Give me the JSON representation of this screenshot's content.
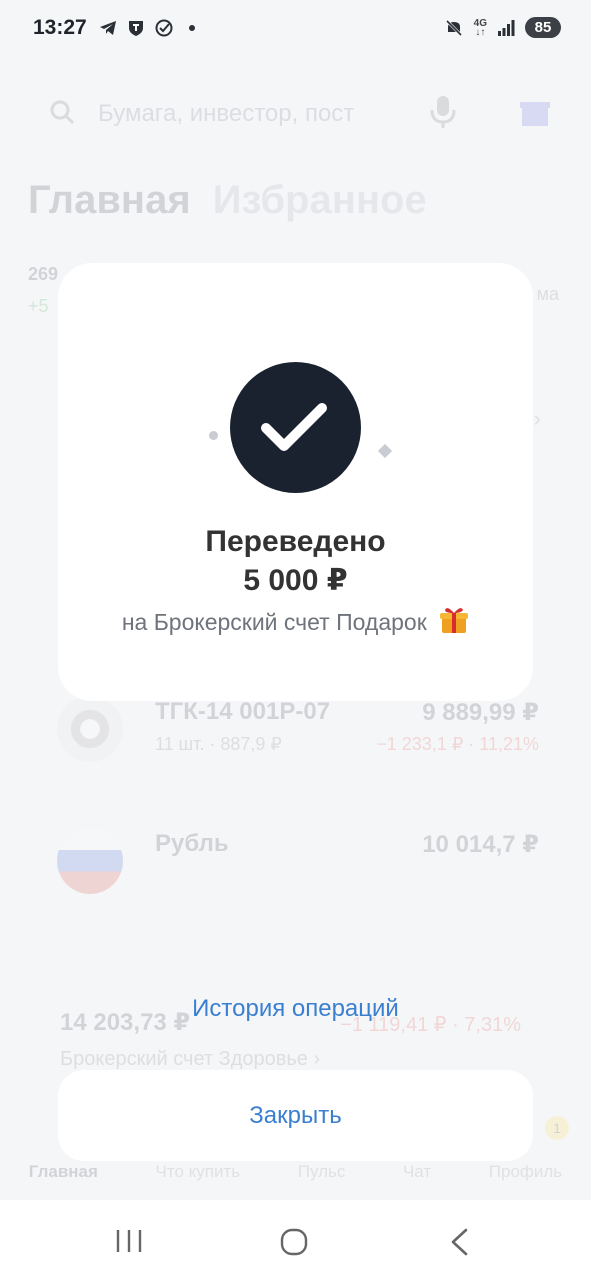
{
  "status_bar": {
    "time": "13:27",
    "network": "4G",
    "battery": "85",
    "icons": [
      "telegram-icon",
      "shield-icon",
      "check-circle-icon",
      "dot-icon",
      "mute-icon",
      "signal-icon"
    ]
  },
  "background": {
    "search_placeholder": "Бумага, инвестор, пост",
    "tab_main": "Главная",
    "tab_favorites": "Избранное",
    "mini_value": "269",
    "mini_change": "+5",
    "mini_right": "ма",
    "assets": [
      {
        "name": "ТГК-14 001Р-07",
        "sub": "11 шт. · 887,9 ₽",
        "value": "9 889,99 ₽",
        "change": "−1 233,1 ₽ · 11,21%"
      },
      {
        "name": "Рубль",
        "sub": "",
        "value": "10 014,7 ₽",
        "change": ""
      }
    ],
    "total": "14 203,73 ₽",
    "total_change": "−1 119,41 ₽ · 7,31%",
    "account": "Брокерский счет Здоровье ›",
    "nav": [
      "Главная",
      "Что купить",
      "Пульс",
      "Чат",
      "Профиль"
    ],
    "badge": "1"
  },
  "dialog": {
    "title": "Переведено",
    "amount": "5 000 ₽",
    "destination": "на Брокерский счет Подарок",
    "history_link": "История операций",
    "close_label": "Закрыть"
  },
  "colors": {
    "check_bg": "#1a2230",
    "link": "#3b7fd0",
    "page_bg": "#f5f6f8"
  }
}
